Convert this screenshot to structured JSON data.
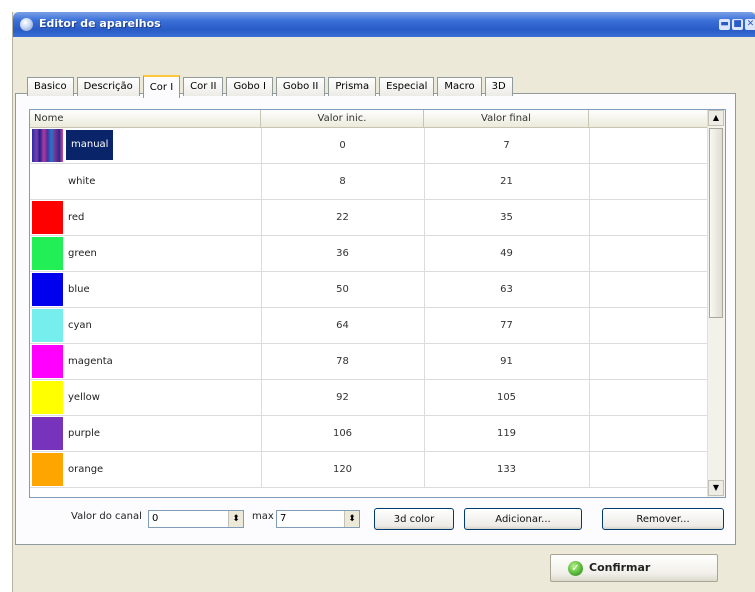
{
  "window": {
    "title": "Editor de aparelhos"
  },
  "title_buttons": {
    "minimize": "▬",
    "maximize": "■",
    "close": "✕"
  },
  "tabs": [
    {
      "label": "Basico",
      "active": false
    },
    {
      "label": "Descrição",
      "active": false
    },
    {
      "label": "Cor I",
      "active": true
    },
    {
      "label": "Cor II",
      "active": false
    },
    {
      "label": "Gobo I",
      "active": false
    },
    {
      "label": "Gobo II",
      "active": false
    },
    {
      "label": "Prisma",
      "active": false
    },
    {
      "label": "Especial",
      "active": false
    },
    {
      "label": "Macro",
      "active": false
    },
    {
      "label": "3D",
      "active": false
    }
  ],
  "grid": {
    "columns": [
      "Nome",
      "Valor inic.",
      "Valor final",
      ""
    ],
    "rows": [
      {
        "name": "manual",
        "start": "0",
        "end": "7",
        "color": "gradient",
        "selected": true
      },
      {
        "name": "white",
        "start": "8",
        "end": "21",
        "color": "#ffffff",
        "selected": false
      },
      {
        "name": "red",
        "start": "22",
        "end": "35",
        "color": "#ff0000",
        "selected": false
      },
      {
        "name": "green",
        "start": "36",
        "end": "49",
        "color": "#22ee55",
        "selected": false
      },
      {
        "name": "blue",
        "start": "50",
        "end": "63",
        "color": "#0000ee",
        "selected": false
      },
      {
        "name": "cyan",
        "start": "64",
        "end": "77",
        "color": "#77eeee",
        "selected": false
      },
      {
        "name": "magenta",
        "start": "78",
        "end": "91",
        "color": "#ff00ff",
        "selected": false
      },
      {
        "name": "yellow",
        "start": "92",
        "end": "105",
        "color": "#ffff00",
        "selected": false
      },
      {
        "name": "purple",
        "start": "106",
        "end": "119",
        "color": "#7733bb",
        "selected": false
      },
      {
        "name": "orange",
        "start": "120",
        "end": "133",
        "color": "#ffa500",
        "selected": false
      }
    ],
    "scroll_up": "▲",
    "scroll_down": "▼"
  },
  "controls": {
    "channel_label": "Valor do canal",
    "channel_value": "0",
    "max_label": "max",
    "max_value": "7",
    "spin_glyph": "⬍",
    "btn_3d_color": "3d color",
    "btn_add": "Adicionar...",
    "btn_remove": "Remover..."
  },
  "confirm": {
    "label": "Confirmar",
    "icon": "✓"
  }
}
